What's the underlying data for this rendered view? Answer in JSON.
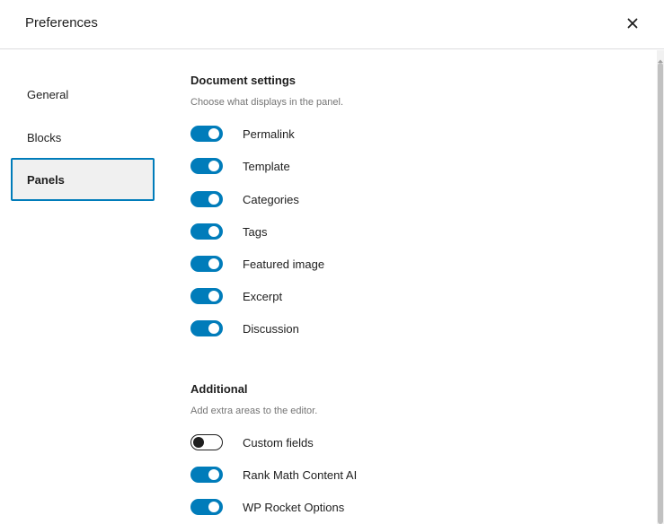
{
  "modal": {
    "title": "Preferences",
    "close_icon": "close-icon"
  },
  "sidebar": {
    "tabs": [
      {
        "label": "General",
        "active": false
      },
      {
        "label": "Blocks",
        "active": false
      },
      {
        "label": "Panels",
        "active": true
      }
    ]
  },
  "sections": {
    "document": {
      "title": "Document settings",
      "description": "Choose what displays in the panel.",
      "options": [
        {
          "label": "Permalink",
          "enabled": true
        },
        {
          "label": "Template",
          "enabled": true
        },
        {
          "label": "Categories",
          "enabled": true
        },
        {
          "label": "Tags",
          "enabled": true
        },
        {
          "label": "Featured image",
          "enabled": true
        },
        {
          "label": "Excerpt",
          "enabled": true
        },
        {
          "label": "Discussion",
          "enabled": true
        }
      ]
    },
    "additional": {
      "title": "Additional",
      "description": "Add extra areas to the editor.",
      "options": [
        {
          "label": "Custom fields",
          "enabled": false
        },
        {
          "label": "Rank Math Content AI",
          "enabled": true
        },
        {
          "label": "WP Rocket Options",
          "enabled": true
        }
      ]
    }
  },
  "colors": {
    "accent": "#007cba",
    "text": "#1e1e1e",
    "muted": "#757575",
    "tab_active_bg": "#f0f0f0"
  }
}
